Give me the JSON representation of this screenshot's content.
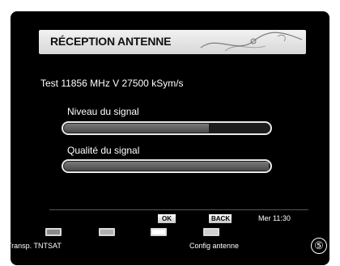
{
  "header": {
    "title": "RÉCEPTION ANTENNE"
  },
  "test_info": "Test 11856 MHz V 27500 kSym/s",
  "signal_level": {
    "label": "Niveau du signal",
    "value_percent": 70
  },
  "signal_quality": {
    "label": "Qualité du signal",
    "value_percent": 99
  },
  "footer": {
    "ok_key": "OK",
    "back_key": "BACK",
    "clock": "Mer 11:30",
    "color_buttons": [
      {
        "color": "#8a8a8a"
      },
      {
        "color": "#b0b0b0"
      },
      {
        "color": "#ffffff"
      },
      {
        "color": "#cfcfcf"
      }
    ],
    "red_label": "Transp. TNTSAT",
    "yellow_label": "Config antenne"
  },
  "step_number": "⑤"
}
